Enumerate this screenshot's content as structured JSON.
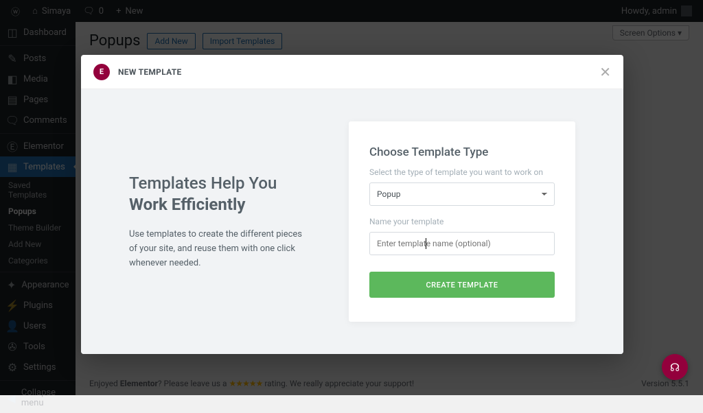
{
  "adminbar": {
    "site_name": "Simaya",
    "comments_count": "0",
    "new_label": "New",
    "howdy": "Howdy, admin"
  },
  "sidebar": {
    "dashboard": "Dashboard",
    "posts": "Posts",
    "media": "Media",
    "pages": "Pages",
    "comments": "Comments",
    "elementor": "Elementor",
    "templates": "Templates",
    "saved_templates": "Saved Templates",
    "popups": "Popups",
    "theme_builder": "Theme Builder",
    "add_new_sub": "Add New",
    "categories": "Categories",
    "appearance": "Appearance",
    "plugins": "Plugins",
    "users": "Users",
    "tools": "Tools",
    "settings": "Settings",
    "collapse": "Collapse menu"
  },
  "page": {
    "title": "Popups",
    "add_new": "Add New",
    "import": "Import Templates",
    "screen_options": "Screen Options"
  },
  "modal": {
    "header": "NEW TEMPLATE",
    "intro_l1": "Templates Help You",
    "intro_l2": "Work Efficiently",
    "intro_body": "Use templates to create the different pieces of your site, and reuse them with one click whenever needed.",
    "form_title": "Choose Template Type",
    "type_label": "Select the type of template you want to work on",
    "type_value": "Popup",
    "name_label": "Name your template",
    "name_placeholder": "Enter template name (optional)",
    "name_value": "",
    "create_btn": "CREATE TEMPLATE"
  },
  "footer": {
    "pre": "Enjoyed ",
    "bold": "Elementor",
    "mid": "? Please leave us a ",
    "stars": "★★★★★",
    "post": " rating. We really appreciate your support!",
    "version": "Version 5.5.1"
  }
}
